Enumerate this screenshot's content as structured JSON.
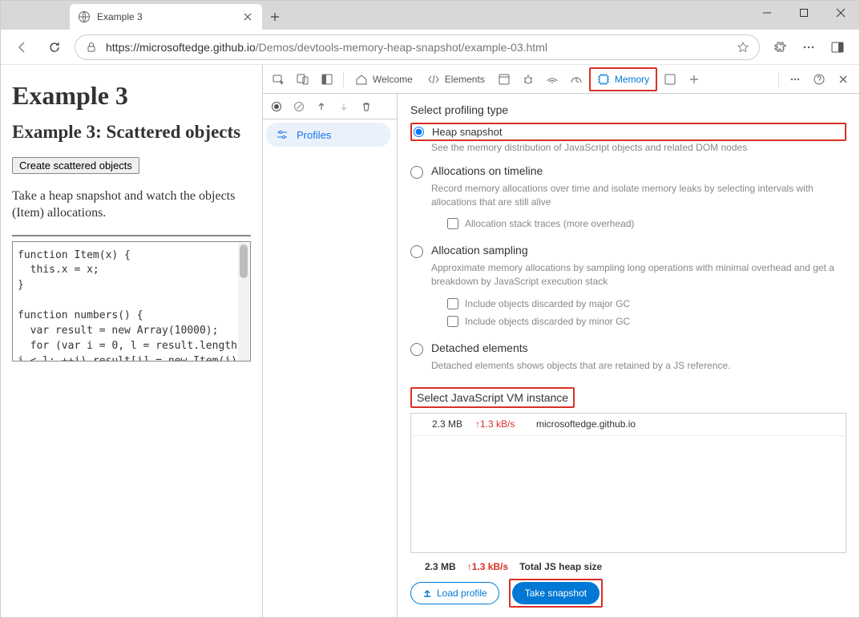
{
  "browser": {
    "tab_title": "Example 3",
    "url_host": "https://microsoftedge.github.io",
    "url_path": "/Demos/devtools-memory-heap-snapshot/example-03.html"
  },
  "page": {
    "h1": "Example 3",
    "h2": "Example 3: Scattered objects",
    "button": "Create scattered objects",
    "instruction": "Take a heap snapshot and watch the objects (Item) allocations.",
    "code": "function Item(x) {\n  this.x = x;\n}\n\nfunction numbers() {\n  var result = new Array(10000);\n  for (var i = 0, l = result.length;\ni < l; ++i) result[i] = new Item(i);\n  return new Item(result);\n}"
  },
  "devtools": {
    "tabs": {
      "welcome": "Welcome",
      "elements": "Elements",
      "memory": "Memory"
    },
    "profiles": "Profiles",
    "select_type": "Select profiling type",
    "options": {
      "heap": {
        "label": "Heap snapshot",
        "desc": "See the memory distribution of JavaScript objects and related DOM nodes"
      },
      "timeline": {
        "label": "Allocations on timeline",
        "desc": "Record memory allocations over time and isolate memory leaks by selecting intervals with allocations that are still alive",
        "check": "Allocation stack traces (more overhead)"
      },
      "sampling": {
        "label": "Allocation sampling",
        "desc": "Approximate memory allocations by sampling long operations with minimal overhead and get a breakdown by JavaScript execution stack",
        "check1": "Include objects discarded by major GC",
        "check2": "Include objects discarded by minor GC"
      },
      "detached": {
        "label": "Detached elements",
        "desc": "Detached elements shows objects that are retained by a JS reference."
      }
    },
    "vm_section": "Select JavaScript VM instance",
    "vm": {
      "size": "2.3 MB",
      "rate": "↑1.3 kB/s",
      "host": "microsoftedge.github.io"
    },
    "footer": {
      "size": "2.3 MB",
      "rate": "↑1.3 kB/s",
      "label": "Total JS heap size"
    },
    "load_profile": "Load profile",
    "take_snapshot": "Take snapshot"
  }
}
